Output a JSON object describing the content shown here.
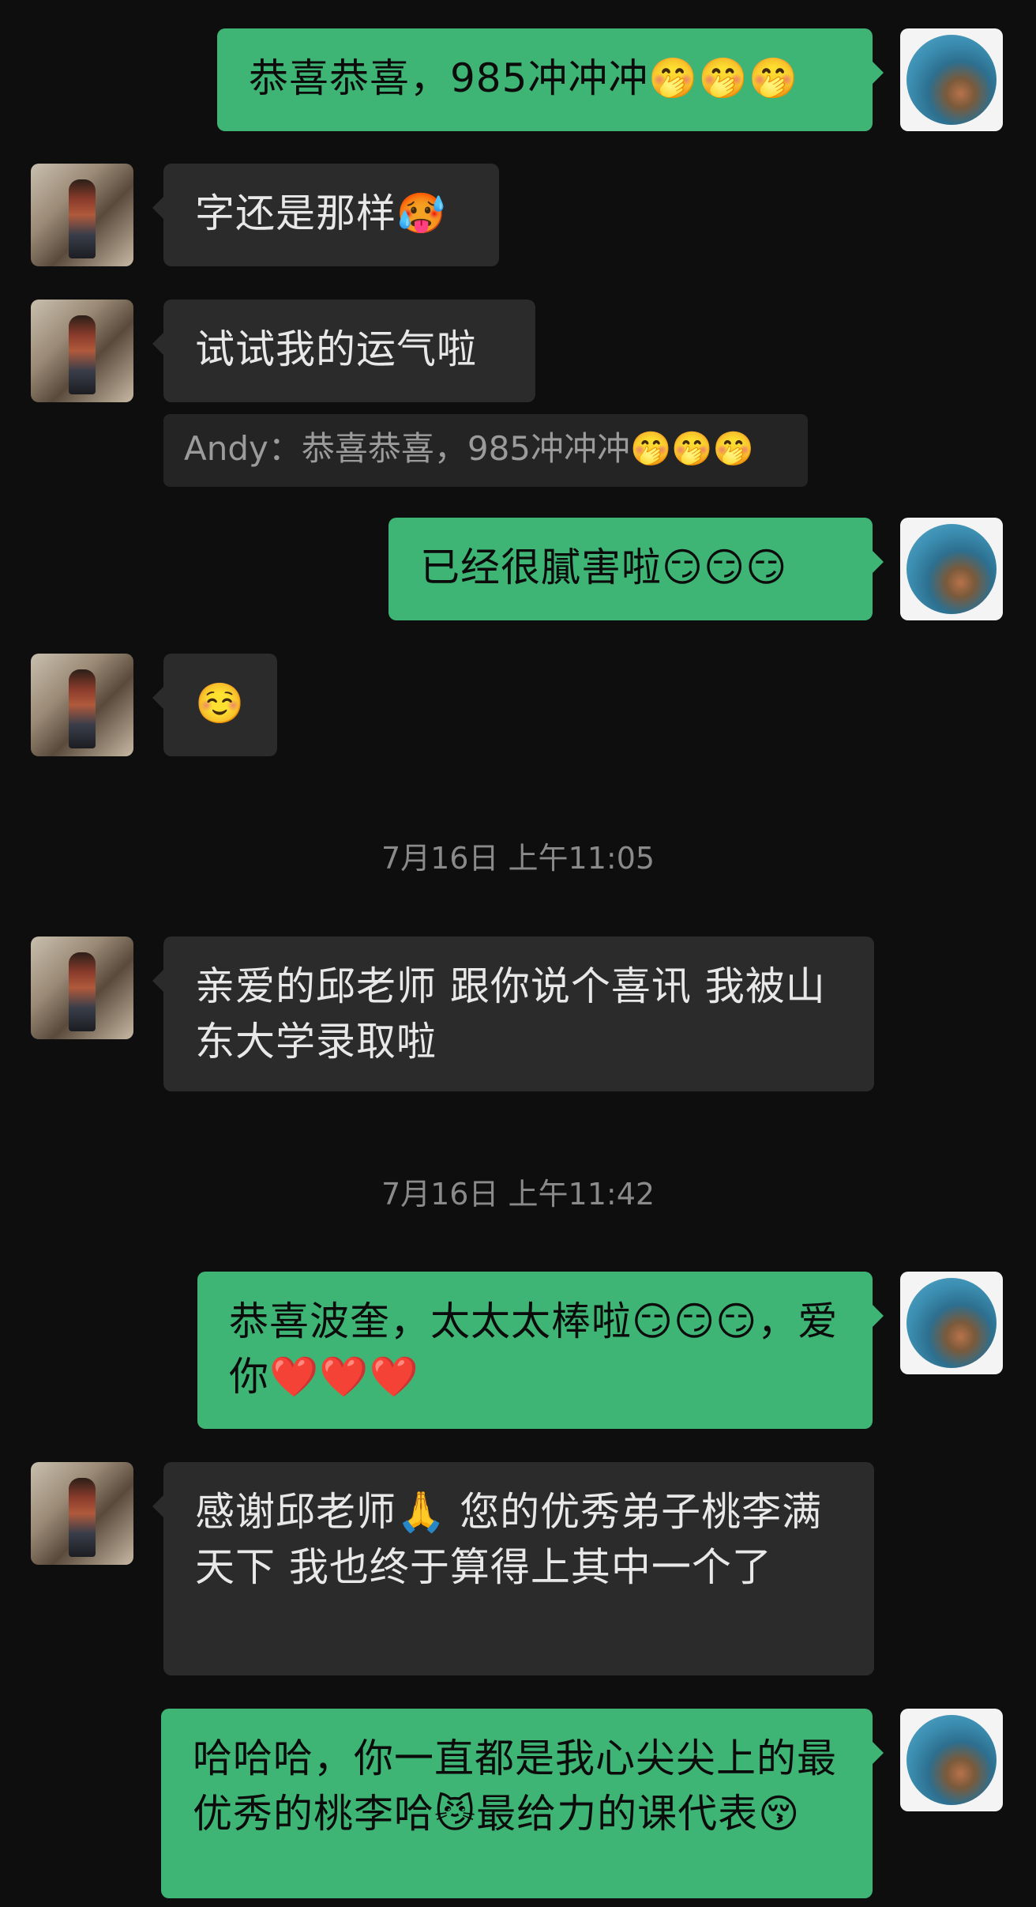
{
  "messages": [
    {
      "id": "m1",
      "side": "right",
      "text": "恭喜恭喜，985冲冲冲🤭🤭🤭"
    },
    {
      "id": "m2",
      "side": "left",
      "text": "字还是那样🥵"
    },
    {
      "id": "m3",
      "side": "left",
      "text": "试试我的运气啦"
    },
    {
      "id": "q1",
      "type": "quote",
      "text": "Andy：恭喜恭喜，985冲冲冲🤭🤭🤭"
    },
    {
      "id": "m4",
      "side": "right",
      "text": "已经很膩害啦😏😏😏"
    },
    {
      "id": "m5",
      "side": "left",
      "text": "☺️"
    },
    {
      "id": "t1",
      "type": "time",
      "text": "7月16日 上午11:05"
    },
    {
      "id": "m6",
      "side": "left",
      "text": "亲爱的邱老师 跟你说个喜讯 我被山东大学录取啦"
    },
    {
      "id": "t2",
      "type": "time",
      "text": "7月16日 上午11:42"
    },
    {
      "id": "m7",
      "side": "right",
      "text": "恭喜波奎，太太太棒啦😏😏😏，爱你❤️❤️❤️"
    },
    {
      "id": "m8",
      "side": "left",
      "text": "感谢邱老师🙏 您的优秀弟子桃李满天下 我也终于算得上其中一个了"
    },
    {
      "id": "m9",
      "side": "right",
      "text": "哈哈哈，你一直都是我心尖尖上的最优秀的桃李哈😼最给力的课代表😚"
    }
  ],
  "colors": {
    "background": "#0e0e0e",
    "bubble_self": "#3eb575",
    "bubble_other": "#2b2b2b"
  }
}
